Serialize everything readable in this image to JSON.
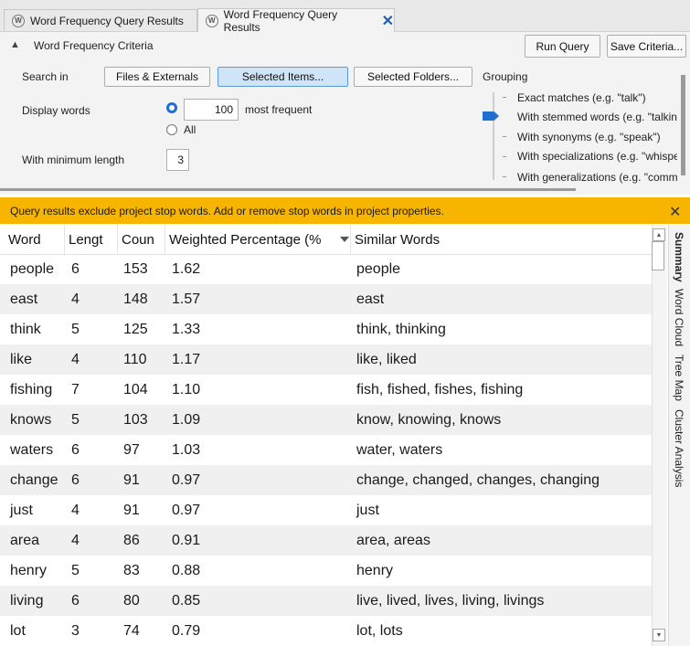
{
  "tabs": [
    {
      "label": "Word Frequency Query Results",
      "active": false
    },
    {
      "label": "Word Frequency Query Results",
      "active": true,
      "close": "✕"
    }
  ],
  "criteria": {
    "title": "Word Frequency Criteria",
    "run_query": "Run Query",
    "save_criteria": "Save Criteria...",
    "search_in_label": "Search in",
    "search_buttons": [
      "Files & Externals",
      "Selected Items...",
      "Selected Folders..."
    ],
    "selected_search": "Selected Items...",
    "display_words_label": "Display words",
    "display_count": "100",
    "most_frequent": "most frequent",
    "all_label": "All",
    "min_length_label": "With minimum length",
    "min_length": "3",
    "grouping_label": "Grouping",
    "grouping_options": [
      "Exact matches (e.g. \"talk\")",
      "With stemmed words (e.g. \"talkin",
      "With synonyms (e.g. \"speak\")",
      "With specializations (e.g. \"whispe",
      "With generalizations (e.g. \"comm"
    ],
    "grouping_selected": 1
  },
  "warning": {
    "text": "Query results exclude project stop words. Add or remove stop words in project properties.",
    "close": "✕"
  },
  "table": {
    "columns": [
      "Word",
      "Lengt",
      "Coun",
      "Weighted Percentage (%",
      "Similar Words"
    ],
    "sorted_column": "Weighted Percentage (%",
    "rows": [
      [
        "people",
        "6",
        "153",
        "1.62",
        "people"
      ],
      [
        "east",
        "4",
        "148",
        "1.57",
        "east"
      ],
      [
        "think",
        "5",
        "125",
        "1.33",
        "think, thinking"
      ],
      [
        "like",
        "4",
        "110",
        "1.17",
        "like, liked"
      ],
      [
        "fishing",
        "7",
        "104",
        "1.10",
        "fish, fished, fishes, fishing"
      ],
      [
        "knows",
        "5",
        "103",
        "1.09",
        "know, knowing, knows"
      ],
      [
        "waters",
        "6",
        "97",
        "1.03",
        "water, waters"
      ],
      [
        "change",
        "6",
        "91",
        "0.97",
        "change, changed, changes, changing"
      ],
      [
        "just",
        "4",
        "91",
        "0.97",
        "just"
      ],
      [
        "area",
        "4",
        "86",
        "0.91",
        "area, areas"
      ],
      [
        "henry",
        "5",
        "83",
        "0.88",
        "henry"
      ],
      [
        "living",
        "6",
        "80",
        "0.85",
        "live, lived, lives, living, livings"
      ],
      [
        "lot",
        "3",
        "74",
        "0.79",
        "lot, lots"
      ]
    ]
  },
  "side_tabs": [
    "Summary",
    "Word Cloud",
    "Tree Map",
    "Cluster Analysis"
  ],
  "active_side_tab": "Summary",
  "colors": {
    "accent": "#1f6fd0",
    "warning": "#f7b500",
    "selected_button": "#cfe4f7"
  }
}
